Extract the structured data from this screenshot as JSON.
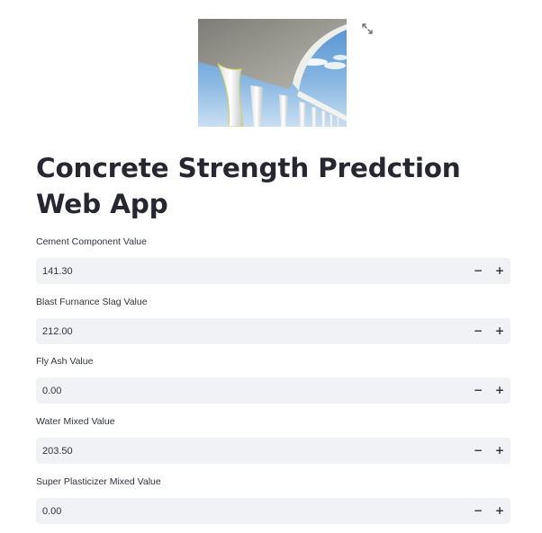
{
  "app": {
    "title": "Concrete Strength Predction Web App"
  },
  "image": {
    "icon": "bridge-photo",
    "fullscreen_icon": "expand-arrows-icon"
  },
  "fields": [
    {
      "label": "Cement Component Value",
      "value": "141.30",
      "minus": "−",
      "plus": "+"
    },
    {
      "label": "Blast Furnance Slag Value",
      "value": "212.00",
      "minus": "−",
      "plus": "+"
    },
    {
      "label": "Fly Ash Value",
      "value": "0.00",
      "minus": "−",
      "plus": "+"
    },
    {
      "label": "Water Mixed Value",
      "value": "203.50",
      "minus": "−",
      "plus": "+"
    },
    {
      "label": "Super Plasticizer Mixed Value",
      "value": "0.00",
      "minus": "−",
      "plus": "+"
    }
  ],
  "colors": {
    "input_bg": "#f0f2f6",
    "text": "#31333f",
    "heading": "#262730"
  }
}
